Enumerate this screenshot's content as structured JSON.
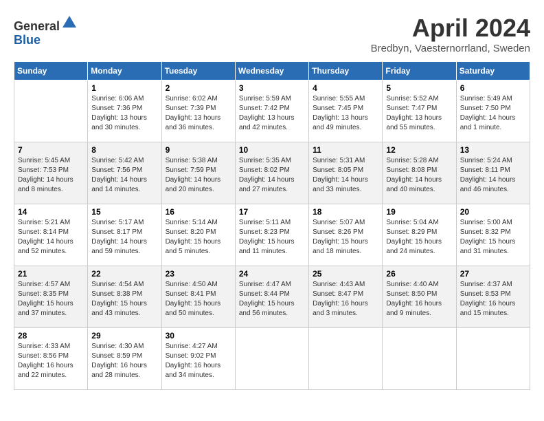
{
  "header": {
    "logo_line1": "General",
    "logo_line2": "Blue",
    "month": "April 2024",
    "location": "Bredbyn, Vaesternorrland, Sweden"
  },
  "days_of_week": [
    "Sunday",
    "Monday",
    "Tuesday",
    "Wednesday",
    "Thursday",
    "Friday",
    "Saturday"
  ],
  "weeks": [
    [
      {
        "day": "",
        "info": ""
      },
      {
        "day": "1",
        "info": "Sunrise: 6:06 AM\nSunset: 7:36 PM\nDaylight: 13 hours\nand 30 minutes."
      },
      {
        "day": "2",
        "info": "Sunrise: 6:02 AM\nSunset: 7:39 PM\nDaylight: 13 hours\nand 36 minutes."
      },
      {
        "day": "3",
        "info": "Sunrise: 5:59 AM\nSunset: 7:42 PM\nDaylight: 13 hours\nand 42 minutes."
      },
      {
        "day": "4",
        "info": "Sunrise: 5:55 AM\nSunset: 7:45 PM\nDaylight: 13 hours\nand 49 minutes."
      },
      {
        "day": "5",
        "info": "Sunrise: 5:52 AM\nSunset: 7:47 PM\nDaylight: 13 hours\nand 55 minutes."
      },
      {
        "day": "6",
        "info": "Sunrise: 5:49 AM\nSunset: 7:50 PM\nDaylight: 14 hours\nand 1 minute."
      }
    ],
    [
      {
        "day": "7",
        "info": "Sunrise: 5:45 AM\nSunset: 7:53 PM\nDaylight: 14 hours\nand 8 minutes."
      },
      {
        "day": "8",
        "info": "Sunrise: 5:42 AM\nSunset: 7:56 PM\nDaylight: 14 hours\nand 14 minutes."
      },
      {
        "day": "9",
        "info": "Sunrise: 5:38 AM\nSunset: 7:59 PM\nDaylight: 14 hours\nand 20 minutes."
      },
      {
        "day": "10",
        "info": "Sunrise: 5:35 AM\nSunset: 8:02 PM\nDaylight: 14 hours\nand 27 minutes."
      },
      {
        "day": "11",
        "info": "Sunrise: 5:31 AM\nSunset: 8:05 PM\nDaylight: 14 hours\nand 33 minutes."
      },
      {
        "day": "12",
        "info": "Sunrise: 5:28 AM\nSunset: 8:08 PM\nDaylight: 14 hours\nand 40 minutes."
      },
      {
        "day": "13",
        "info": "Sunrise: 5:24 AM\nSunset: 8:11 PM\nDaylight: 14 hours\nand 46 minutes."
      }
    ],
    [
      {
        "day": "14",
        "info": "Sunrise: 5:21 AM\nSunset: 8:14 PM\nDaylight: 14 hours\nand 52 minutes."
      },
      {
        "day": "15",
        "info": "Sunrise: 5:17 AM\nSunset: 8:17 PM\nDaylight: 14 hours\nand 59 minutes."
      },
      {
        "day": "16",
        "info": "Sunrise: 5:14 AM\nSunset: 8:20 PM\nDaylight: 15 hours\nand 5 minutes."
      },
      {
        "day": "17",
        "info": "Sunrise: 5:11 AM\nSunset: 8:23 PM\nDaylight: 15 hours\nand 11 minutes."
      },
      {
        "day": "18",
        "info": "Sunrise: 5:07 AM\nSunset: 8:26 PM\nDaylight: 15 hours\nand 18 minutes."
      },
      {
        "day": "19",
        "info": "Sunrise: 5:04 AM\nSunset: 8:29 PM\nDaylight: 15 hours\nand 24 minutes."
      },
      {
        "day": "20",
        "info": "Sunrise: 5:00 AM\nSunset: 8:32 PM\nDaylight: 15 hours\nand 31 minutes."
      }
    ],
    [
      {
        "day": "21",
        "info": "Sunrise: 4:57 AM\nSunset: 8:35 PM\nDaylight: 15 hours\nand 37 minutes."
      },
      {
        "day": "22",
        "info": "Sunrise: 4:54 AM\nSunset: 8:38 PM\nDaylight: 15 hours\nand 43 minutes."
      },
      {
        "day": "23",
        "info": "Sunrise: 4:50 AM\nSunset: 8:41 PM\nDaylight: 15 hours\nand 50 minutes."
      },
      {
        "day": "24",
        "info": "Sunrise: 4:47 AM\nSunset: 8:44 PM\nDaylight: 15 hours\nand 56 minutes."
      },
      {
        "day": "25",
        "info": "Sunrise: 4:43 AM\nSunset: 8:47 PM\nDaylight: 16 hours\nand 3 minutes."
      },
      {
        "day": "26",
        "info": "Sunrise: 4:40 AM\nSunset: 8:50 PM\nDaylight: 16 hours\nand 9 minutes."
      },
      {
        "day": "27",
        "info": "Sunrise: 4:37 AM\nSunset: 8:53 PM\nDaylight: 16 hours\nand 15 minutes."
      }
    ],
    [
      {
        "day": "28",
        "info": "Sunrise: 4:33 AM\nSunset: 8:56 PM\nDaylight: 16 hours\nand 22 minutes."
      },
      {
        "day": "29",
        "info": "Sunrise: 4:30 AM\nSunset: 8:59 PM\nDaylight: 16 hours\nand 28 minutes."
      },
      {
        "day": "30",
        "info": "Sunrise: 4:27 AM\nSunset: 9:02 PM\nDaylight: 16 hours\nand 34 minutes."
      },
      {
        "day": "",
        "info": ""
      },
      {
        "day": "",
        "info": ""
      },
      {
        "day": "",
        "info": ""
      },
      {
        "day": "",
        "info": ""
      }
    ]
  ]
}
